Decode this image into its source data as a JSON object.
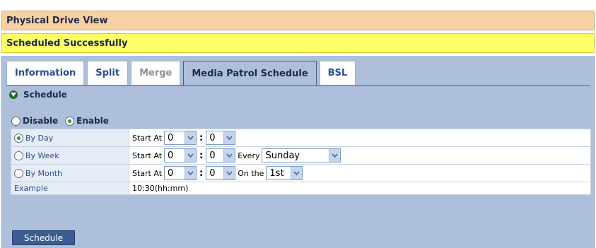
{
  "title": "Physical Drive View",
  "status": "Scheduled Successfully",
  "tabs": [
    {
      "label": "Information",
      "state": "normal"
    },
    {
      "label": "Split",
      "state": "normal"
    },
    {
      "label": "Merge",
      "state": "disabled"
    },
    {
      "label": "Media Patrol Schedule",
      "state": "active"
    },
    {
      "label": "BSL",
      "state": "normal"
    }
  ],
  "section": {
    "title": "Schedule",
    "icon": "collapse-icon"
  },
  "mode": {
    "disable_label": "Disable",
    "enable_label": "Enable",
    "selected": "Enable"
  },
  "rows": {
    "day": {
      "label": "By Day",
      "selected": true,
      "start_label": "Start At",
      "hour": "0",
      "minute": "0"
    },
    "week": {
      "label": "By Week",
      "selected": false,
      "start_label": "Start At",
      "hour": "0",
      "minute": "0",
      "every_label": "Every",
      "day": "Sunday"
    },
    "month": {
      "label": "By Month",
      "selected": false,
      "start_label": "Start At",
      "hour": "0",
      "minute": "0",
      "onthe_label": "On the",
      "date": "1st"
    }
  },
  "example": {
    "label": "Example",
    "value": "10:30(hh:mm)"
  },
  "colon": ":",
  "button": {
    "label": "Schedule"
  },
  "colors": {
    "title_bg": "#f8d1a3",
    "status_bg": "#ffff66",
    "panel_bg": "#adbfdb",
    "button_bg": "#3a5c92"
  }
}
